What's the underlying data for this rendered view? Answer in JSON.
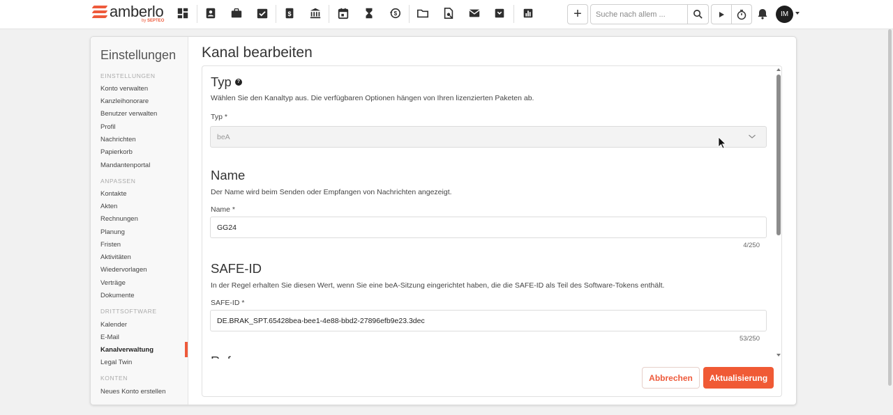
{
  "app": {
    "logo_text": "amberlo",
    "logo_sub_by": "by",
    "logo_sub_brand": "SEPTEO"
  },
  "topbar": {
    "search_placeholder": "Suche nach allem ...",
    "avatar_initials": "IM",
    "icons": [
      "dashboard-icon",
      "contacts-icon",
      "briefcase-icon",
      "tasks-icon",
      "invoice-icon",
      "bank-icon",
      "calendar-icon",
      "hourglass-icon",
      "time-history-icon",
      "folder-icon",
      "document-search-icon",
      "mail-icon",
      "inbox-icon",
      "reports-icon"
    ]
  },
  "sidebar": {
    "title": "Einstellungen",
    "sections": [
      {
        "label": "EINSTELLUNGEN",
        "items": [
          "Konto verwalten",
          "Kanzleihonorare",
          "Benutzer verwalten",
          "Profil",
          "Nachrichten",
          "Papierkorb",
          "Mandantenportal"
        ]
      },
      {
        "label": "ANPASSEN",
        "items": [
          "Kontakte",
          "Akten",
          "Rechnungen",
          "Planung",
          "Fristen",
          "Aktivitäten",
          "Wiedervorlagen",
          "Verträge",
          "Dokumente"
        ]
      },
      {
        "label": "DRITTSOFTWARE",
        "items": [
          "Kalender",
          "E-Mail",
          "Kanalverwaltung",
          "Legal Twin"
        ]
      },
      {
        "label": "KONTEN",
        "items": [
          "Neues Konto erstellen"
        ]
      }
    ],
    "active_item": "Kanalverwaltung"
  },
  "main": {
    "title": "Kanal bearbeiten",
    "type_section": {
      "title": "Typ",
      "description": "Wählen Sie den Kanaltyp aus. Die verfügbaren Optionen hängen von Ihren lizenzierten Paketen ab.",
      "label": "Typ *",
      "value": "beA"
    },
    "name_section": {
      "title": "Name",
      "description": "Der Name wird beim Senden oder Empfangen von Nachrichten angezeigt.",
      "label": "Name *",
      "value": "GG24",
      "counter": "4/250"
    },
    "safe_section": {
      "title": "SAFE-ID",
      "description": "In der Regel erhalten Sie diesen Wert, wenn Sie eine beA-Sitzung eingerichtet haben, die die SAFE-ID als Teil des Software-Tokens enthält.",
      "label": "SAFE-ID *",
      "value": "DE.BRAK_SPT.65428bea-bee1-4e88-bbd2-27896efb9e23.3dec",
      "counter": "53/250"
    },
    "next_section_title": "Referenzen",
    "cancel_label": "Abbrechen",
    "update_label": "Aktualisierung"
  },
  "colors": {
    "accent": "#f05a35",
    "brand": "#ee5a3b"
  }
}
